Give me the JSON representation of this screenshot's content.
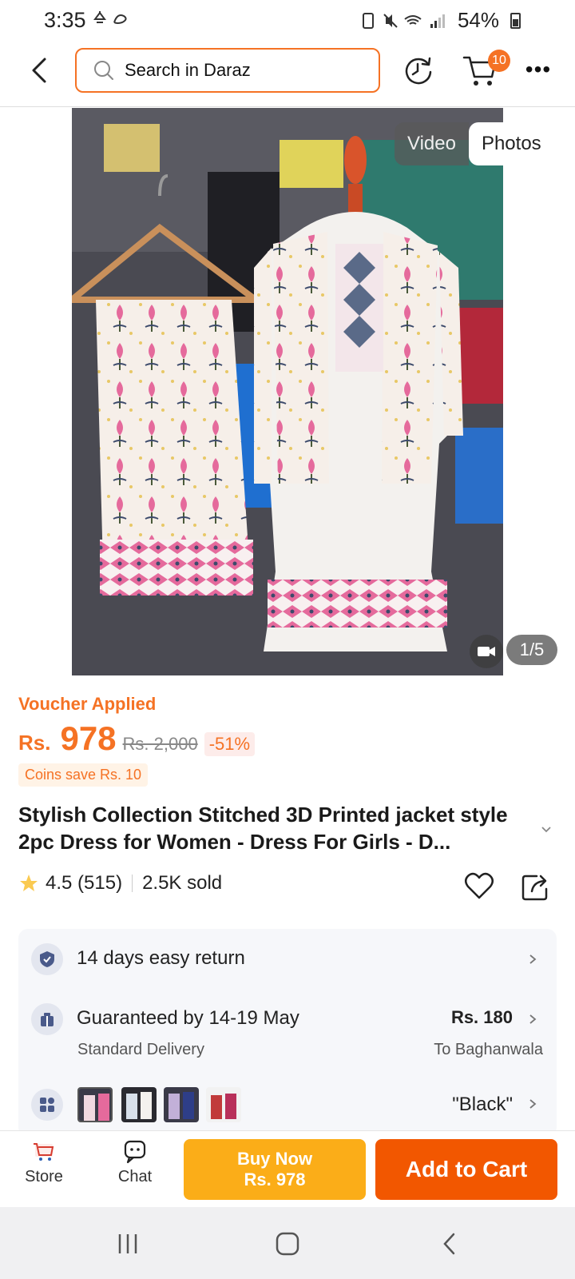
{
  "status_bar": {
    "time": "3:35",
    "battery": "54%"
  },
  "header": {
    "search_placeholder": "Search in Daraz",
    "cart_count": "10"
  },
  "media": {
    "tabs": [
      "Video",
      "Photos"
    ],
    "active_tab": "Photos",
    "counter": "1/5"
  },
  "pricing": {
    "voucher_label": "Voucher Applied",
    "currency": "Rs.",
    "price": "978",
    "original_price": "Rs. 2,000",
    "discount": "-51%",
    "coins": "Coins save Rs. 10"
  },
  "product": {
    "title": "Stylish Collection Stitched 3D Printed jacket style 2pc Dress for Women - Dress For Girls - D...",
    "rating": "4.5 (515)",
    "sold": "2.5K sold"
  },
  "info": {
    "return_policy": "14 days easy return",
    "delivery_title": "Guaranteed by 14-19 May",
    "delivery_type": "Standard Delivery",
    "delivery_fee": "Rs. 180",
    "delivery_to": "To Baghanwala",
    "selected_variant": "\"Black\""
  },
  "actions": {
    "store_label": "Store",
    "chat_label": "Chat",
    "buy_now_line1": "Buy Now",
    "buy_now_line2": "Rs. 978",
    "add_to_cart": "Add to Cart"
  },
  "colors": {
    "accent": "#f57224",
    "buy_now": "#fbad18",
    "add_to_cart": "#f25700"
  }
}
